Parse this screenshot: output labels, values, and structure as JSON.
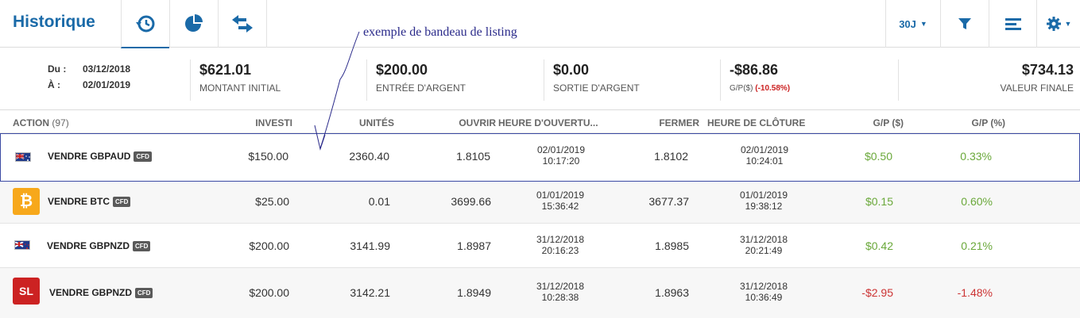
{
  "header": {
    "title": "Historique",
    "period_label": "30J"
  },
  "annotation": "exemple de bandeau de listing",
  "summary": {
    "from_label": "Du :",
    "from_value": "03/12/2018",
    "to_label": "À :",
    "to_value": "02/01/2019",
    "initial_amount": "$621.01",
    "initial_amount_label": "MONTANT INITIAL",
    "cash_in": "$200.00",
    "cash_in_label": "ENTRÉE D'ARGENT",
    "cash_out": "$0.00",
    "cash_out_label": "SORTIE D'ARGENT",
    "pnl": "-$86.86",
    "pnl_label": "G/P($)",
    "pnl_percent": "(-10.58%)",
    "final_value": "$734.13",
    "final_value_label": "VALEUR FINALE"
  },
  "columns": {
    "action": "ACTION",
    "action_count": "(97)",
    "invested": "INVESTI",
    "units": "UNITÉS",
    "open": "OUVRIR",
    "open_time": "HEURE D'OUVERTU...",
    "close": "FERMER",
    "close_time": "HEURE DE CLÔTURE",
    "pnl_usd": "G/P ($)",
    "pnl_pct": "G/P (%)"
  },
  "rows": [
    {
      "action": "VENDRE GBPAUD",
      "tag": "CFD",
      "invested": "$150.00",
      "units": "2360.40",
      "open": "1.8105",
      "open_date": "02/01/2019",
      "open_time": "10:17:20",
      "close": "1.8102",
      "close_date": "02/01/2019",
      "close_time": "10:24:01",
      "pnl_usd": "$0.50",
      "pnl_pct": "0.33%"
    },
    {
      "action": "VENDRE BTC",
      "tag": "CFD",
      "icon_text": "₿",
      "invested": "$25.00",
      "units": "0.01",
      "open": "3699.66",
      "open_date": "01/01/2019",
      "open_time": "15:36:42",
      "close": "3677.37",
      "close_date": "01/01/2019",
      "close_time": "19:38:12",
      "pnl_usd": "$0.15",
      "pnl_pct": "0.60%"
    },
    {
      "action": "VENDRE GBPNZD",
      "tag": "CFD",
      "invested": "$200.00",
      "units": "3141.99",
      "open": "1.8987",
      "open_date": "31/12/2018",
      "open_time": "20:16:23",
      "close": "1.8985",
      "close_date": "31/12/2018",
      "close_time": "20:21:49",
      "pnl_usd": "$0.42",
      "pnl_pct": "0.21%"
    },
    {
      "action": "VENDRE GBPNZD",
      "tag": "CFD",
      "icon_text": "SL",
      "invested": "$200.00",
      "units": "3142.21",
      "open": "1.8949",
      "open_date": "31/12/2018",
      "open_time": "10:28:38",
      "close": "1.8963",
      "close_date": "31/12/2018",
      "close_time": "10:36:49",
      "pnl_usd": "-$2.95",
      "pnl_pct": "-1.48%"
    }
  ],
  "colors": {
    "brand": "#1a6aa8",
    "positive": "#6aa83a",
    "negative": "#cc3333",
    "selection": "#3b4aa3",
    "annotation": "#2a2a8a"
  },
  "icons": {
    "tab_history": "history-icon",
    "tab_chart": "pie-chart-icon",
    "tab_transfer": "transfer-icon",
    "filter": "filter-icon",
    "list": "list-icon",
    "settings": "gear-icon"
  }
}
